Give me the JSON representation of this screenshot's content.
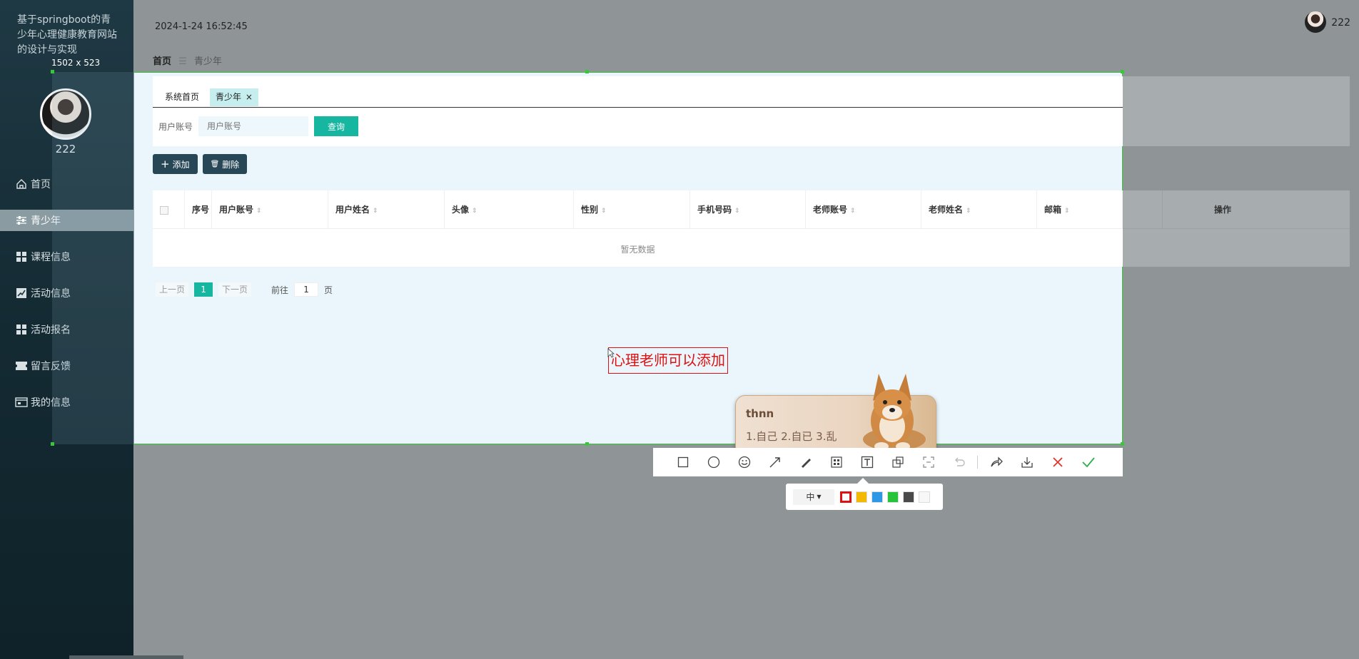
{
  "app": {
    "title": "基于springboot的青少年心理健康教育网站的设计与实现",
    "username": "222"
  },
  "header": {
    "datetime": "2024-1-24 16:52:45",
    "username": "222"
  },
  "sidebar": {
    "items": [
      {
        "label": "首页",
        "icon": "home-icon"
      },
      {
        "label": "青少年",
        "icon": "sliders-icon",
        "active": true
      },
      {
        "label": "课程信息",
        "icon": "grid-icon"
      },
      {
        "label": "活动信息",
        "icon": "chart-icon"
      },
      {
        "label": "活动报名",
        "icon": "grid-icon"
      },
      {
        "label": "留言反馈",
        "icon": "ticket-icon"
      },
      {
        "label": "我的信息",
        "icon": "profile-icon"
      }
    ]
  },
  "breadcrumb": {
    "home": "首页",
    "separator": "☰",
    "current": "青少年"
  },
  "tabs": [
    {
      "label": "系统首页"
    },
    {
      "label": "青少年",
      "close": "×"
    }
  ],
  "search": {
    "label": "用户账号",
    "placeholder": "用户账号",
    "button": "查询"
  },
  "actions": {
    "add": "添加",
    "delete": "删除",
    "add_icon": "+",
    "delete_icon": "🗑"
  },
  "table": {
    "columns": [
      "序号",
      "用户账号",
      "用户姓名",
      "头像",
      "性别",
      "手机号码",
      "老师账号",
      "老师姓名",
      "邮箱",
      "操作"
    ],
    "empty_text": "暂无数据"
  },
  "pagination": {
    "prev": "上一页",
    "current": "1",
    "next": "下一页",
    "goto_label": "前往",
    "goto_value": "1",
    "page_suffix": "页"
  },
  "screenshot_tool": {
    "size_label": "1502 x 523",
    "annotation_text": "心理老师可以添加",
    "size_option": "中",
    "colors": [
      "#d11a1a",
      "#f3b800",
      "#2f98e6",
      "#27c33a",
      "#4a4a4a",
      "#f7f7f7"
    ],
    "selected_color": "#d11a1a"
  },
  "ime": {
    "input": "thnn",
    "candidates": "1.自己  2.自已  3.乱"
  }
}
